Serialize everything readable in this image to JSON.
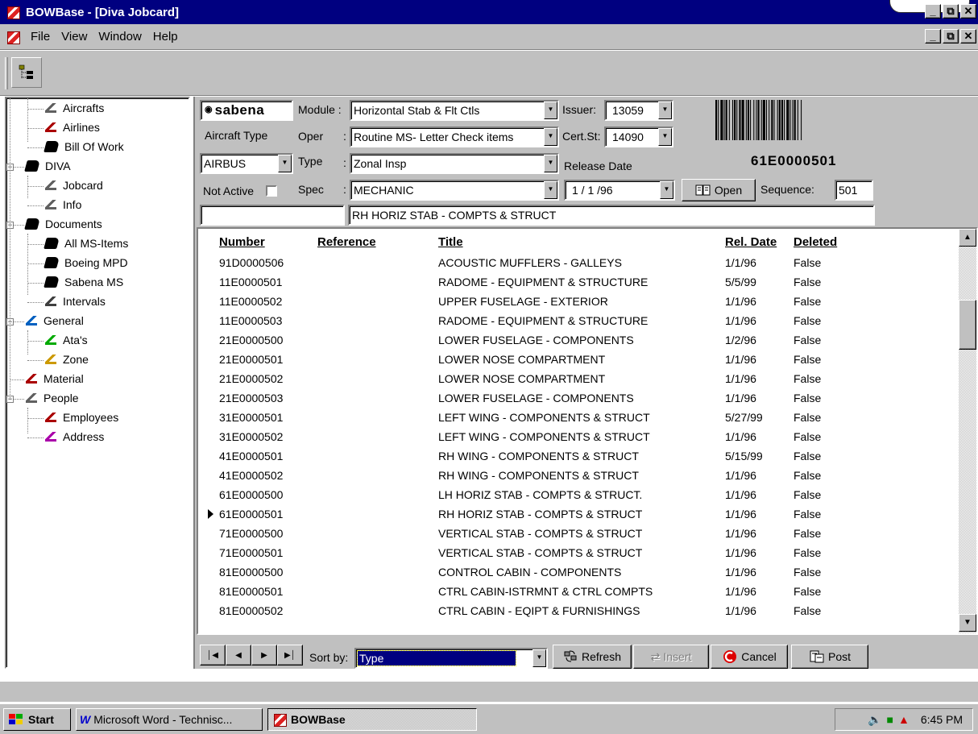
{
  "window": {
    "title": "BOWBase - [Diva Jobcard]"
  },
  "menu": [
    "File",
    "View",
    "Window",
    "Help"
  ],
  "tree": [
    {
      "label": "Aircrafts",
      "icon": "aircraft-icon",
      "level": 1
    },
    {
      "label": "Airlines",
      "icon": "airline-icon",
      "level": 1
    },
    {
      "label": "Bill Of Work",
      "icon": "book-icon",
      "level": 1
    },
    {
      "label": "DIVA",
      "icon": "book-icon",
      "level": 0
    },
    {
      "label": "Jobcard",
      "icon": "jobcard-icon",
      "level": 1
    },
    {
      "label": "Info",
      "icon": "info-icon",
      "level": 1
    },
    {
      "label": "Documents",
      "icon": "book-icon",
      "level": 0
    },
    {
      "label": "All MS-Items",
      "icon": "book-icon",
      "level": 1
    },
    {
      "label": "Boeing MPD",
      "icon": "book-icon",
      "level": 1
    },
    {
      "label": "Sabena MS",
      "icon": "book-icon",
      "level": 1
    },
    {
      "label": "Intervals",
      "icon": "intervals-icon",
      "level": 1
    },
    {
      "label": "General",
      "icon": "general-icon",
      "level": 0
    },
    {
      "label": "Ata's",
      "icon": "ata-icon",
      "level": 1
    },
    {
      "label": "Zone",
      "icon": "zone-icon",
      "level": 1
    },
    {
      "label": "Material",
      "icon": "material-icon",
      "level": 0
    },
    {
      "label": "People",
      "icon": "people-icon",
      "level": 0
    },
    {
      "label": "Employees",
      "icon": "employees-icon",
      "level": 1
    },
    {
      "label": "Address",
      "icon": "address-icon",
      "level": 1
    }
  ],
  "form": {
    "logo": "sabena",
    "module_label": "Module :",
    "module_value": "Horizontal Stab & Flt Ctls",
    "issuer_label": "Issuer:",
    "issuer_value": "13059",
    "aircraft_type_label": "Aircraft Type",
    "oper_label": "Oper",
    "oper_colon": ":",
    "oper_value": "Routine MS- Letter Check items",
    "certst_label": "Cert.St:",
    "certst_value": "14090",
    "aircraft_type_value": "AIRBUS",
    "type_label": "Type",
    "type_colon": ":",
    "type_value": "Zonal Insp",
    "release_date_label": "Release Date",
    "not_active_label": "Not Active",
    "spec_label": "Spec",
    "spec_colon": ":",
    "spec_value": "MECHANIC",
    "release_date_value": "1 / 1 /96",
    "open_label": "Open",
    "sequence_label": "Sequence:",
    "sequence_value": "501",
    "barcode_text": "61E0000501",
    "description": "RH HORIZ STAB - COMPTS & STRUCT"
  },
  "grid": {
    "headers": [
      "Number",
      "Reference",
      "Title",
      "Rel. Date",
      "Deleted"
    ],
    "rows": [
      [
        "91D0000506",
        "",
        "ACOUSTIC MUFFLERS  -  GALLEYS",
        "1/1/96",
        "False"
      ],
      [
        "11E0000501",
        "",
        "RADOME - EQUIPMENT & STRUCTURE",
        "5/5/99",
        "False"
      ],
      [
        "11E0000502",
        "",
        "UPPER FUSELAGE - EXTERIOR",
        "1/1/96",
        "False"
      ],
      [
        "11E0000503",
        "",
        "RADOME - EQUIPMENT & STRUCTURE",
        "1/1/96",
        "False"
      ],
      [
        "21E0000500",
        "",
        "LOWER FUSELAGE - COMPONENTS",
        "1/2/96",
        "False"
      ],
      [
        "21E0000501",
        "",
        "LOWER NOSE COMPARTMENT",
        "1/1/96",
        "False"
      ],
      [
        "21E0000502",
        "",
        "LOWER NOSE COMPARTMENT",
        "1/1/96",
        "False"
      ],
      [
        "21E0000503",
        "",
        "LOWER FUSELAGE - COMPONENTS",
        "1/1/96",
        "False"
      ],
      [
        "31E0000501",
        "",
        "LEFT WING - COMPONENTS & STRUCT",
        "5/27/99",
        "False"
      ],
      [
        "31E0000502",
        "",
        "LEFT WING - COMPONENTS & STRUCT",
        "1/1/96",
        "False"
      ],
      [
        "41E0000501",
        "",
        "RH WING - COMPONENTS & STRUCT",
        "5/15/99",
        "False"
      ],
      [
        "41E0000502",
        "",
        "RH WING - COMPONENTS & STRUCT",
        "1/1/96",
        "False"
      ],
      [
        "61E0000500",
        "",
        "LH HORIZ STAB - COMPTS & STRUCT.",
        "1/1/96",
        "False"
      ],
      [
        "61E0000501",
        "",
        "RH HORIZ STAB - COMPTS & STRUCT",
        "1/1/96",
        "False"
      ],
      [
        "71E0000500",
        "",
        "VERTICAL STAB - COMPTS & STRUCT",
        "1/1/96",
        "False"
      ],
      [
        "71E0000501",
        "",
        "VERTICAL STAB - COMPTS & STRUCT",
        "1/1/96",
        "False"
      ],
      [
        "81E0000500",
        "",
        "CONTROL CABIN - COMPONENTS",
        "1/1/96",
        "False"
      ],
      [
        "81E0000501",
        "",
        "CTRL CABIN-ISTRMNT & CTRL COMPTS",
        "1/1/96",
        "False"
      ],
      [
        "81E0000502",
        "",
        "CTRL CABIN - EQIPT & FURNISHINGS",
        "1/1/96",
        "False"
      ]
    ],
    "current_row": 13
  },
  "nav": {
    "sortby_label": "Sort by:",
    "sortby_value": "Type",
    "refresh_label": "Refresh",
    "insert_label": "Insert",
    "cancel_label": "Cancel",
    "post_label": "Post"
  },
  "taskbar": {
    "start_label": "Start",
    "task1": "Microsoft Word - Technisc...",
    "task2": "BOWBase",
    "clock": "6:45 PM"
  },
  "colors": {
    "titlebar": "#000080",
    "face": "#c0c0c0",
    "selection": "#000080"
  }
}
